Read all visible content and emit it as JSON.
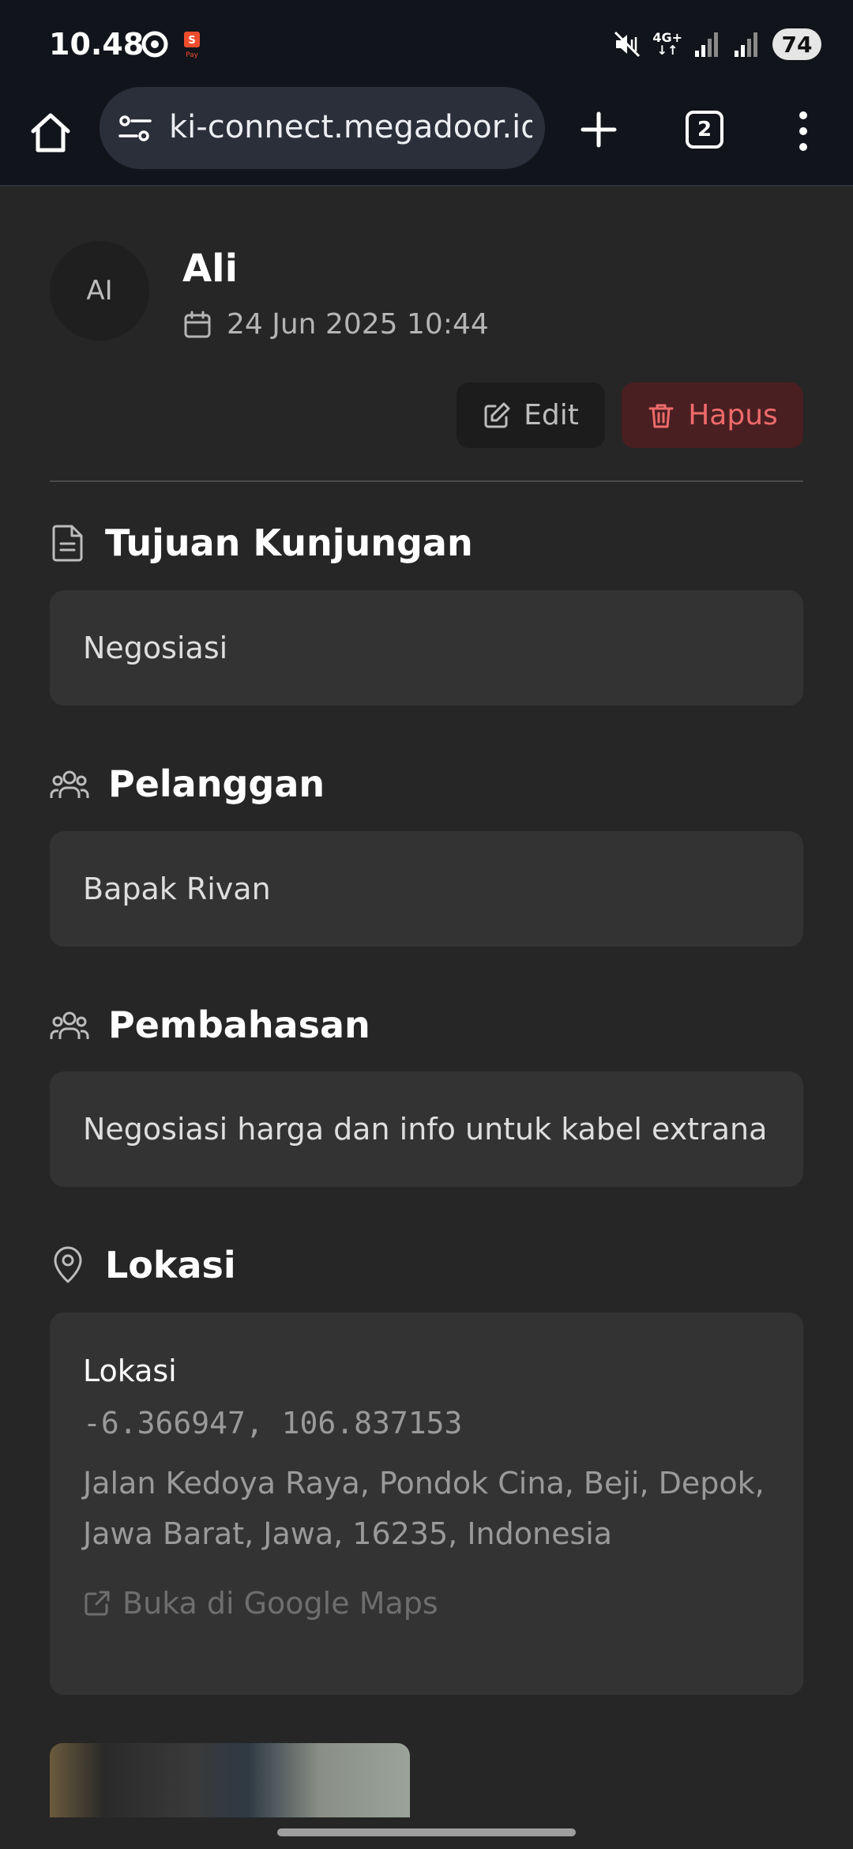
{
  "status_bar": {
    "time": "10.48",
    "network": "4G+",
    "battery": "74",
    "icons": [
      "circle-app-icon",
      "shopeepay-icon",
      "mute-vibrate-icon",
      "signal-icon",
      "signal-icon"
    ]
  },
  "browser": {
    "url": "ki-connect.megadoor.id",
    "tab_count": "2"
  },
  "visit": {
    "avatar_initials": "AI",
    "user_name": "Ali",
    "date": "24 Jun 2025 10:44",
    "edit_label": "Edit",
    "delete_label": "Hapus"
  },
  "sections": {
    "purpose": {
      "title": "Tujuan Kunjungan",
      "value": "Negosiasi"
    },
    "customer": {
      "title": "Pelanggan",
      "value": "Bapak Rivan"
    },
    "discussion": {
      "title": "Pembahasan",
      "value": "Negosiasi harga dan info untuk kabel extrana"
    },
    "location": {
      "title": "Lokasi",
      "card_title": "Lokasi",
      "coordinates": "-6.366947, 106.837153",
      "address": "Jalan Kedoya Raya, Pondok Cina, Beji, Depok, Jawa Barat, Jawa, 16235, Indonesia",
      "maps_link": "Buka di Google Maps"
    }
  },
  "colors": {
    "background": "#262626",
    "card": "#333333",
    "danger_bg": "#4a1f22",
    "danger_text": "#ef6b6b",
    "browser_chrome": "#12141b"
  }
}
